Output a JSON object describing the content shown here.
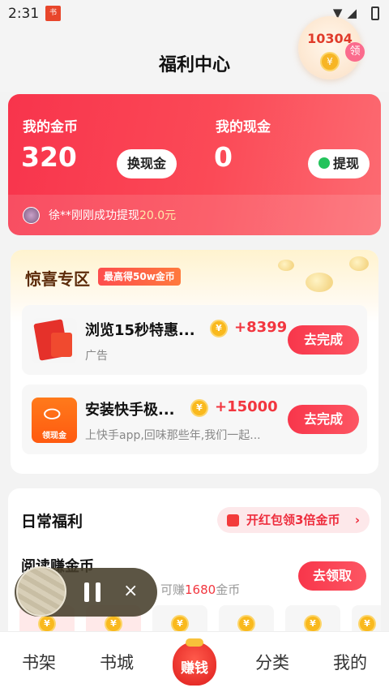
{
  "status_bar": {
    "time": "2:31",
    "app_badge": "书",
    "icons": "▼◢"
  },
  "header": {
    "title": "福利中心",
    "bubble_amount": "10304",
    "bubble_tag": "领",
    "coin_symbol": "¥"
  },
  "wallet": {
    "coins_label": "我的金币",
    "coins_value": "320",
    "exchange_button": "换现金",
    "cash_label": "我的现金",
    "cash_value": "0",
    "withdraw_button": "提现",
    "ticker_text": "徐**刚刚成功提现",
    "ticker_amount": "20.0元"
  },
  "surprise": {
    "title": "惊喜专区",
    "badge": "最高得50w金币",
    "tasks": [
      {
        "title": "浏览15秒特惠...",
        "reward": "+8399",
        "subtitle": "广告",
        "button": "去完成"
      },
      {
        "title": "安装快手极...",
        "reward": "+15000",
        "subtitle": "上快手app,回味那些年,我们一起...",
        "button": "去完成",
        "thumb_tag": "领现金"
      }
    ]
  },
  "daily": {
    "title": "日常福利",
    "promo": "开红包领3倍金币",
    "read_title": "阅读赚金币",
    "read_sub_prefix": "可赚",
    "read_sub_amount": "1680",
    "read_sub_suffix": "金币",
    "claim_button": "去领取"
  },
  "tabbar": {
    "bookshelf": "书架",
    "bookstore": "书城",
    "earn": "赚钱",
    "category": "分类",
    "mine": "我的"
  },
  "colors": {
    "accent": "#f8364b",
    "coin": "#f9b91e",
    "brand_brown": "#5c2b0a"
  }
}
